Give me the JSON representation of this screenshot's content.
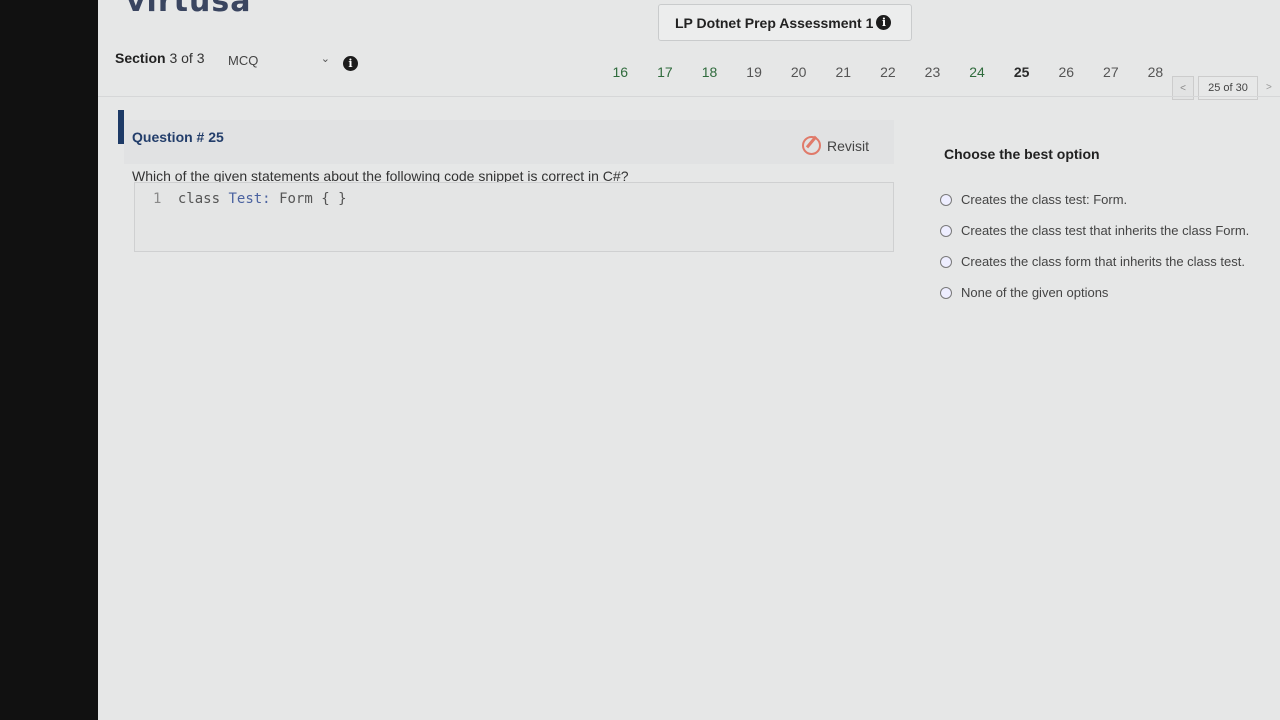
{
  "header": {
    "logo_text": "virtusa",
    "assessment_title": "LP Dotnet Prep Assessment 1",
    "info_glyph": "i"
  },
  "section": {
    "label_prefix": "Section",
    "label_value": "3 of 3",
    "selected_type": "MCQ"
  },
  "question_nav": {
    "numbers": [
      {
        "n": "16",
        "state": "answered"
      },
      {
        "n": "17",
        "state": "answered"
      },
      {
        "n": "18",
        "state": "answered"
      },
      {
        "n": "19",
        "state": "unanswered"
      },
      {
        "n": "20",
        "state": "unanswered"
      },
      {
        "n": "21",
        "state": "unanswered"
      },
      {
        "n": "22",
        "state": "unanswered"
      },
      {
        "n": "23",
        "state": "unanswered"
      },
      {
        "n": "24",
        "state": "answered"
      },
      {
        "n": "25",
        "state": "current"
      },
      {
        "n": "26",
        "state": "unanswered"
      },
      {
        "n": "27",
        "state": "unanswered"
      },
      {
        "n": "28",
        "state": "unanswered"
      }
    ],
    "prev_label": "<",
    "page_count": "25 of 30",
    "next_label": ">"
  },
  "question": {
    "title": "Question # 25",
    "revisit_label": "Revisit",
    "text": "Which of the given statements about the following code snippet is correct in C#?",
    "code": {
      "line_number": "1",
      "keyword": "class",
      "class_name": "Test:",
      "rest": "Form { }"
    }
  },
  "answers": {
    "heading": "Choose the best option",
    "options": [
      "Creates the class test: Form.",
      "Creates the class test that inherits the class Form.",
      "Creates the class form that inherits the class test.",
      "None of the given options"
    ]
  },
  "colors": {
    "background": "#e6e7e7",
    "accent": "#1d3a66",
    "answered": "#2f6b3c",
    "revisit_icon": "#e07a6a"
  }
}
